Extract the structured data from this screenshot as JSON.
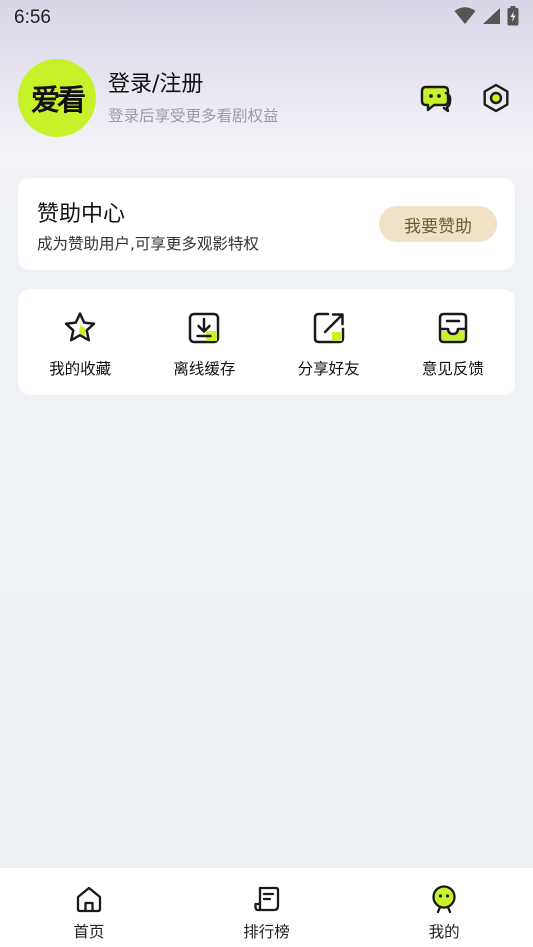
{
  "status_bar": {
    "time": "6:56",
    "icons": [
      "wifi-icon",
      "signal-icon",
      "battery-charging-icon"
    ]
  },
  "profile": {
    "avatar_text": "爱看",
    "title": "登录/注册",
    "subtitle": "登录后享受更多看剧权益",
    "actions": [
      "message-icon",
      "settings-icon"
    ]
  },
  "sponsor": {
    "title": "赞助中心",
    "subtitle": "成为赞助用户,可享更多观影特权",
    "button_label": "我要赞助"
  },
  "features": [
    {
      "label": "我的收藏",
      "icon": "star-icon"
    },
    {
      "label": "离线缓存",
      "icon": "download-icon"
    },
    {
      "label": "分享好友",
      "icon": "share-icon"
    },
    {
      "label": "意见反馈",
      "icon": "feedback-inbox-icon"
    }
  ],
  "tabs": [
    {
      "label": "首页",
      "icon": "home-icon"
    },
    {
      "label": "排行榜",
      "icon": "ranking-icon"
    },
    {
      "label": "我的",
      "icon": "profile-face-icon",
      "selected": true
    }
  ],
  "colors": {
    "accent": "#c7f22a",
    "sponsor_button_bg": "#efe2c6",
    "sponsor_button_text": "#6a5b3d",
    "page_bg": "#edf1f6"
  }
}
